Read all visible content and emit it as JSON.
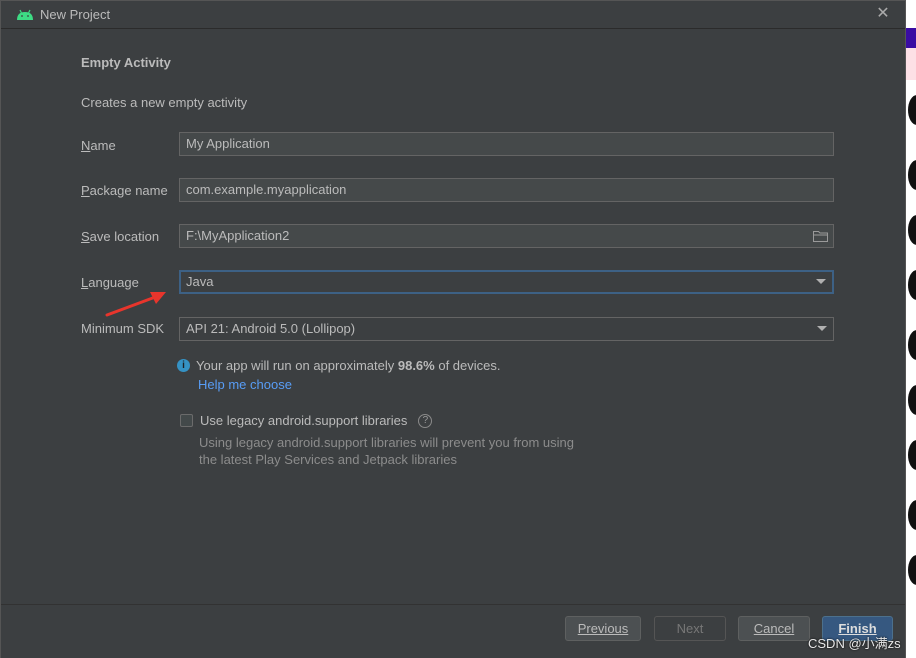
{
  "window": {
    "title": "New Project",
    "close_icon": "close-icon",
    "app_icon": "android-icon"
  },
  "form": {
    "heading": "Empty Activity",
    "description": "Creates a new empty activity",
    "name": {
      "label_first": "N",
      "label_rest": "ame",
      "value": "My Application"
    },
    "package": {
      "label_first": "P",
      "label_rest": "ackage name",
      "value": "com.example.myapplication"
    },
    "save_location": {
      "label_first": "S",
      "label_rest": "ave location",
      "value": "F:\\MyApplication2",
      "icon": "folder-icon"
    },
    "language": {
      "label_first": "L",
      "label_rest": "anguage",
      "value": "Java"
    },
    "min_sdk": {
      "label": "Minimum SDK",
      "value": "API 21: Android 5.0 (Lollipop)"
    },
    "info": {
      "prefix": "Your app will run on approximately ",
      "percent": "98.6%",
      "suffix": " of devices."
    },
    "help_link": "Help me choose",
    "legacy": {
      "label": "Use legacy android.support libraries",
      "checked": false,
      "desc_line1": "Using legacy android.support libraries will prevent you from using",
      "desc_line2": "the latest Play Services and Jetpack libraries"
    }
  },
  "buttons": {
    "previous": "Previous",
    "next": "Next",
    "cancel": "Cancel",
    "finish": "Finish"
  },
  "watermark": "CSDN @小满zs",
  "colors": {
    "dialog_bg": "#3c3f41",
    "field_bg": "#45494a",
    "focus_border": "#3d6185",
    "link": "#589df6",
    "primary_button": "#365880",
    "annotation_arrow": "#e8352c"
  }
}
